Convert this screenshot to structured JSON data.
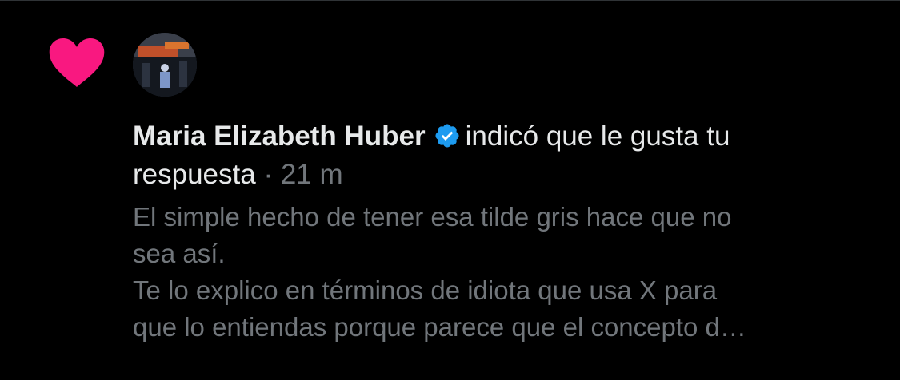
{
  "notification": {
    "type": "like",
    "heart_color": "#f91880",
    "author": "Maria Elizabeth Huber",
    "verified_badge": "verified-badge-icon",
    "verified_color": "#1d9bf0",
    "action_text": "indicó que le gusta tu",
    "action_text_cont": "respuesta",
    "separator": " · ",
    "time": "21 m",
    "reply_lines": [
      "El simple hecho de tener esa tilde gris hace que no",
      "sea así.",
      "Te lo explico en términos de idiota que usa X para",
      "que lo entiendas porque parece que el concepto d…"
    ]
  }
}
